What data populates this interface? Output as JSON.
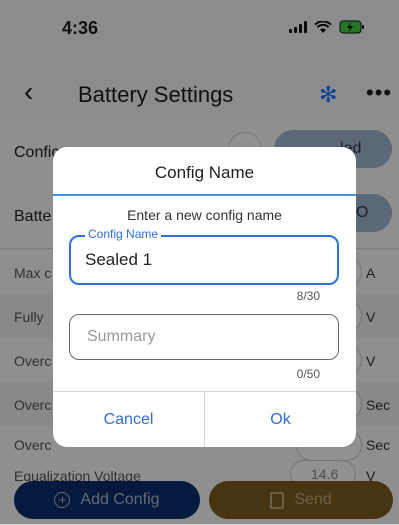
{
  "status": {
    "time": "4:36"
  },
  "nav": {
    "title": "Battery Settings",
    "back_icon": "chevron-left-icon",
    "bluetooth_icon": "bluetooth-icon",
    "more_icon": "more-icon"
  },
  "background": {
    "config_label": "Confic",
    "config_value": "led",
    "battery_label": "Batte",
    "battery_value": "O",
    "rows": [
      {
        "label": "Max c",
        "unit": "A"
      },
      {
        "label": "Fully",
        "unit": "V"
      },
      {
        "label": "Overc",
        "unit": "V"
      },
      {
        "label": "Overc",
        "unit": "Sec"
      },
      {
        "label": "Overc",
        "unit": "Sec"
      }
    ],
    "equalization": {
      "label": "Equalization Voltage",
      "value": "14.6",
      "unit": "V"
    }
  },
  "dialog": {
    "title": "Config Name",
    "prompt": "Enter a new config name",
    "name_field": {
      "label": "Config Name",
      "value": "Sealed 1",
      "counter": "8/30"
    },
    "summary_field": {
      "placeholder": "Summary",
      "counter": "0/50"
    },
    "cancel_label": "Cancel",
    "ok_label": "Ok"
  },
  "footer": {
    "add_label": "Add Config",
    "send_label": "Send"
  },
  "colors": {
    "accent": "#2f6fd6",
    "add_button": "#0b2e6d",
    "send_button": "#7a5c1e"
  }
}
